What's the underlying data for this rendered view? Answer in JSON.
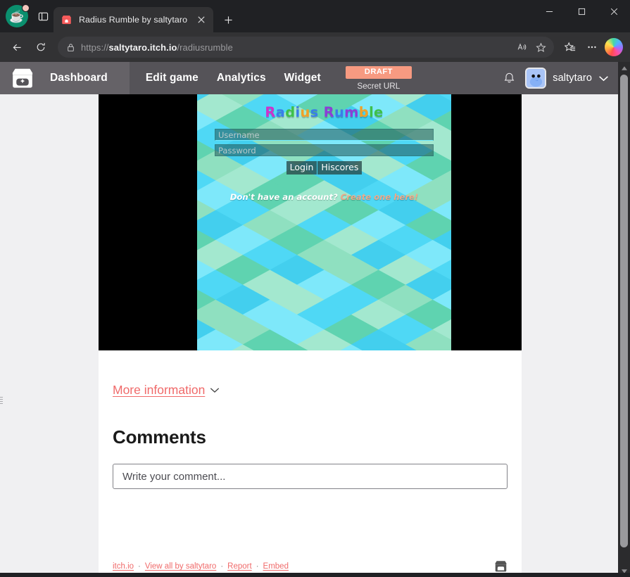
{
  "browser": {
    "profile_icon": "coffee-profile-icon",
    "tab_list_icon": "tab-list-icon",
    "tab": {
      "favicon": "itchio-favicon",
      "title": "Radius Rumble by saltytaro",
      "close_icon": "close-icon"
    },
    "new_tab_icon": "plus-icon",
    "window_controls": {
      "minimize": "minimize-icon",
      "maximize": "maximize-icon",
      "close": "close-icon"
    },
    "toolbar": {
      "back_icon": "back-arrow-icon",
      "refresh_icon": "refresh-icon",
      "lock_icon": "lock-icon",
      "url_scheme": "https://",
      "url_host": "saltytaro.itch.io",
      "url_path": "/radiusrumble",
      "read_aloud_icon": "read-aloud-icon",
      "favorite_icon": "star-icon",
      "collections_icon": "collections-star-icon",
      "settings_icon": "ellipsis-icon",
      "copilot_icon": "copilot-icon"
    }
  },
  "itch_nav": {
    "logo_icon": "itchio-logo-icon",
    "dashboard_label": "Dashboard",
    "links": [
      {
        "label": "Edit game"
      },
      {
        "label": "Analytics"
      },
      {
        "label": "Widget"
      }
    ],
    "draft_badge": "DRAFT",
    "secret_url_label": "Secret URL",
    "bell_icon": "bell-icon",
    "avatar_icon": "user-avatar",
    "username": "saltytaro",
    "chevron_icon": "chevron-down-icon"
  },
  "game": {
    "title_letters": [
      {
        "ch": "R",
        "color": "pink"
      },
      {
        "ch": "a",
        "color": "blue"
      },
      {
        "ch": "d",
        "color": "green"
      },
      {
        "ch": "i",
        "color": "blue"
      },
      {
        "ch": "u",
        "color": "orange"
      },
      {
        "ch": "s",
        "color": "blue"
      },
      {
        "ch": " ",
        "color": "blue"
      },
      {
        "ch": "R",
        "color": "purple"
      },
      {
        "ch": "u",
        "color": "blue"
      },
      {
        "ch": "m",
        "color": "purple"
      },
      {
        "ch": "b",
        "color": "orange"
      },
      {
        "ch": "l",
        "color": "green"
      },
      {
        "ch": "e",
        "color": "green"
      }
    ],
    "title_text": "Radius Rumble",
    "username_placeholder": "Username",
    "password_placeholder": "Password",
    "login_button": "Login",
    "hiscores_button": "Hiscores",
    "signup_prompt": "Don't have an account? ",
    "signup_link": "Create one here!",
    "hex_colors": [
      "#4fd8f5",
      "#7ee8fa",
      "#5fd3b0",
      "#8fe0c0",
      "#a3e8cf",
      "#43cfee"
    ]
  },
  "page": {
    "more_information": "More information",
    "more_info_chevron": "chevron-down-icon",
    "comments_heading": "Comments",
    "comment_placeholder": "Write your comment...",
    "footer": {
      "links": [
        "itch.io",
        "View all by saltytaro",
        "Report",
        "Embed"
      ],
      "separator": "·",
      "logo_icon": "itchio-logo-icon"
    }
  },
  "colors": {
    "itch_red": "#f06a6a",
    "draft_orange": "#f79a81",
    "nav_grey": "#555358",
    "nav_active_grey": "#656267"
  },
  "scrollbar": {
    "up_icon": "scroll-up-arrow-icon",
    "down_icon": "scroll-down-arrow-icon",
    "thumb": "scrollbar-thumb"
  }
}
